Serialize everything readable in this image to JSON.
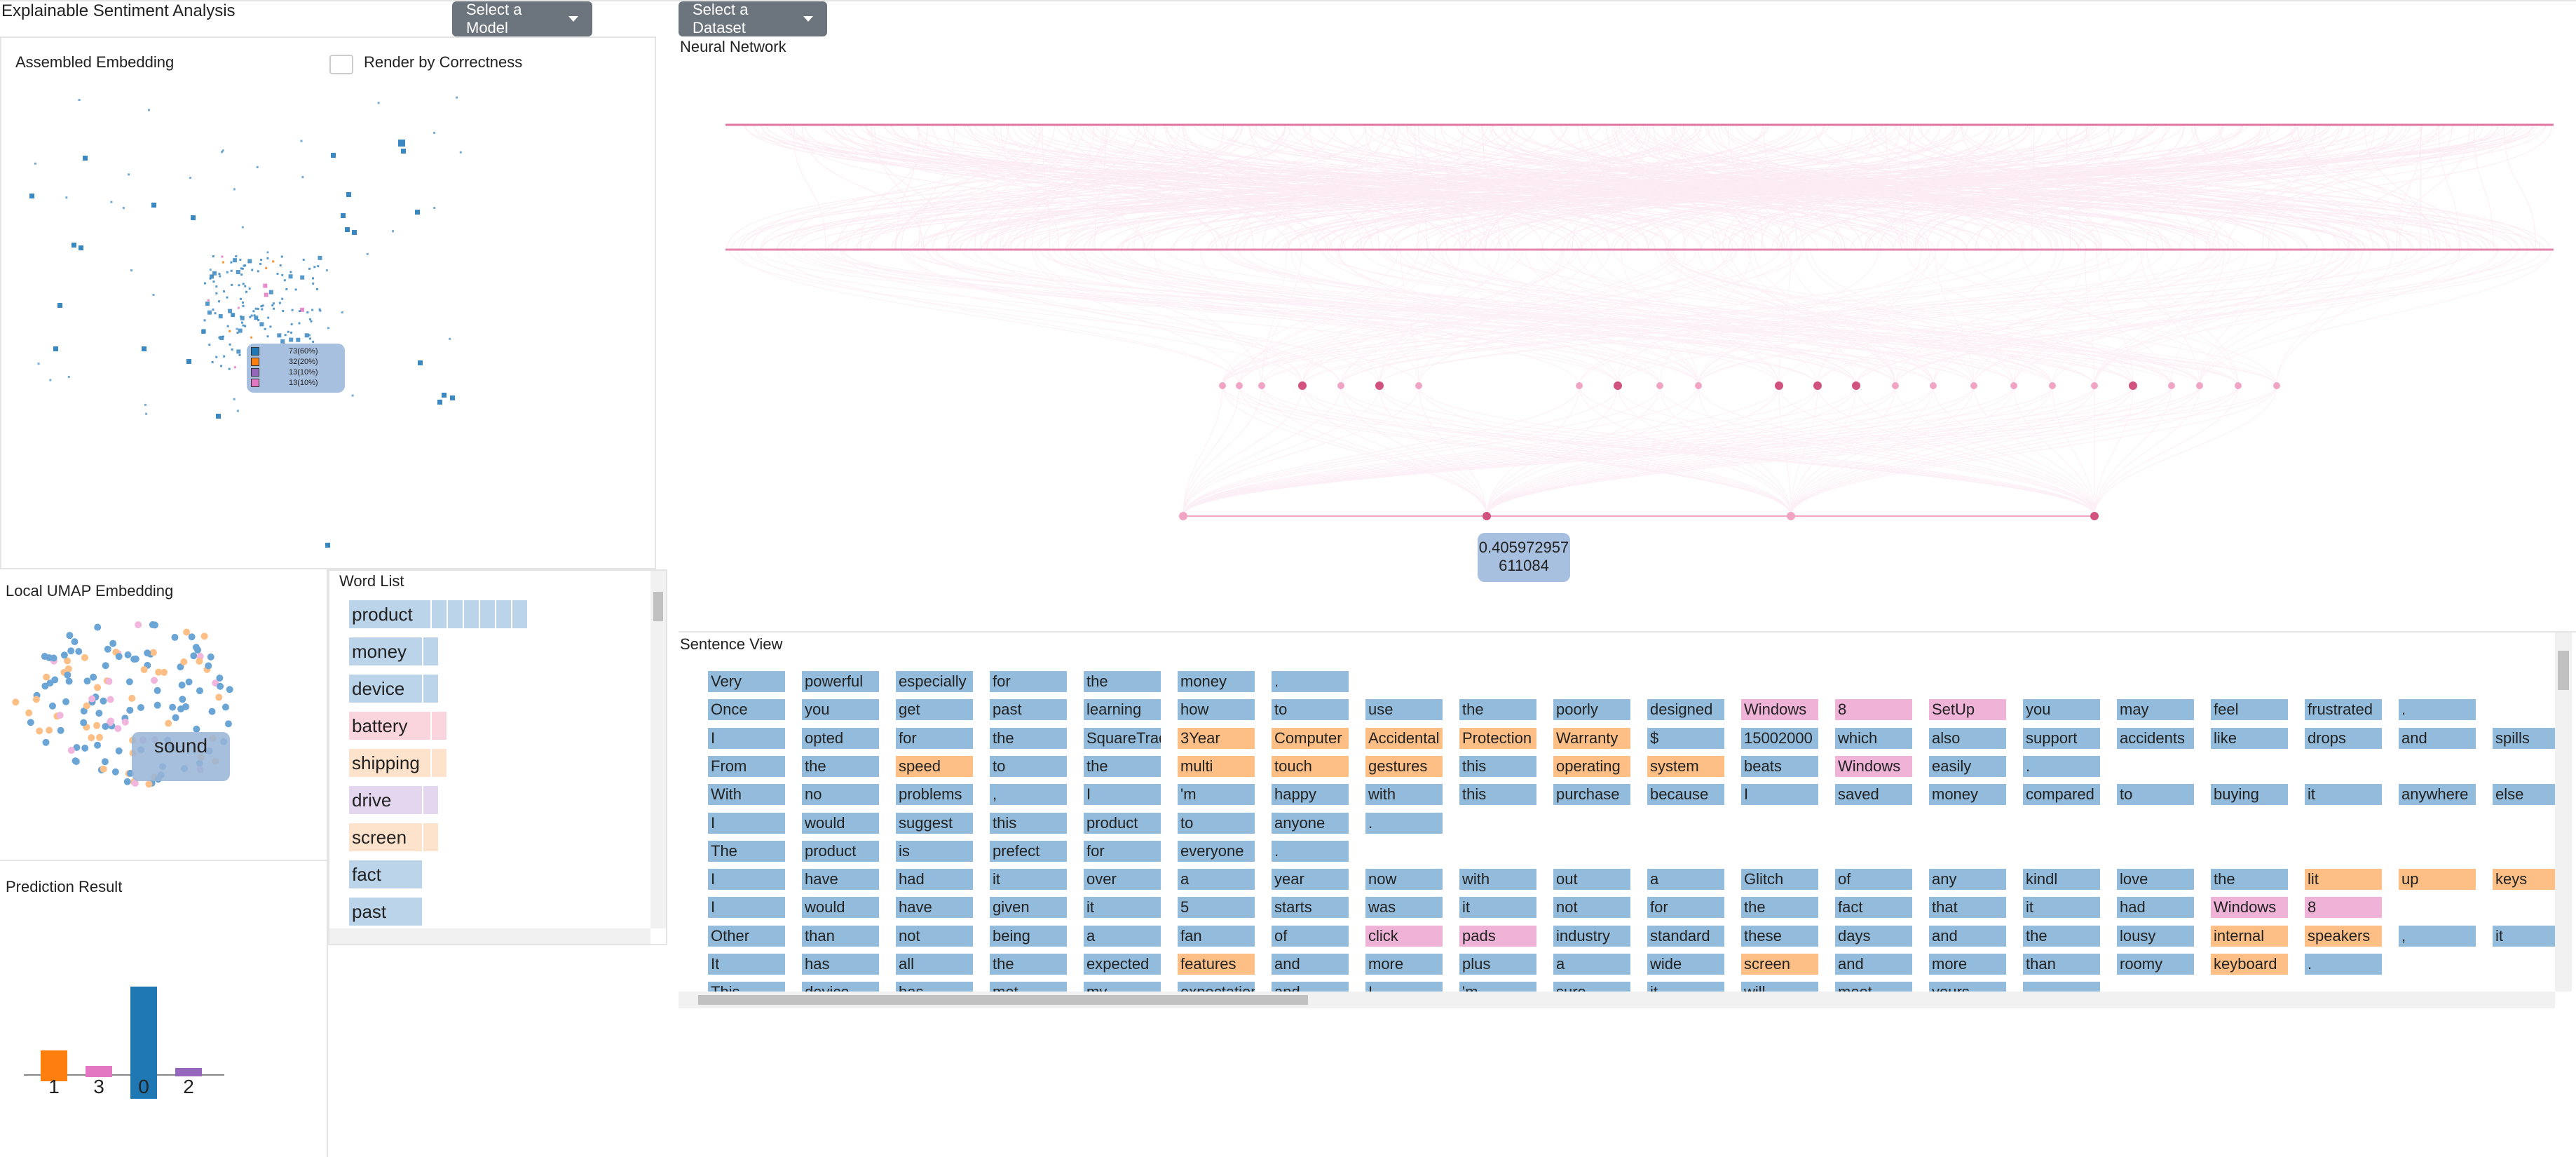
{
  "app": {
    "title": "Explainable Sentiment Analysis",
    "model_button": "Select a Model",
    "dataset_button": "Select a Dataset"
  },
  "assembled": {
    "title": "Assembled Embedding",
    "checkbox_label": "Render by Correctness",
    "tooltip": [
      "73(60%)",
      "32(20%)",
      "13(10%)",
      "13(10%)"
    ]
  },
  "neural": {
    "title": "Neural Network",
    "tooltip_line1": "0.405972957",
    "tooltip_line2": "611084"
  },
  "umap": {
    "title": "Local UMAP Embedding",
    "tooltip": "sound"
  },
  "wordlist": {
    "title": "Word List",
    "words": [
      {
        "w": "product",
        "c": "#bcd4ea",
        "n": 6
      },
      {
        "w": "money",
        "c": "#bcd4ea",
        "n": 1
      },
      {
        "w": "device",
        "c": "#bcd4ea",
        "n": 1
      },
      {
        "w": "battery",
        "c": "#fbd5dd",
        "n": 1
      },
      {
        "w": "shipping",
        "c": "#fde3cc",
        "n": 1
      },
      {
        "w": "drive",
        "c": "#e3d6ee",
        "n": 1
      },
      {
        "w": "screen",
        "c": "#fde3cc",
        "n": 1
      },
      {
        "w": "fact",
        "c": "#bcd4ea",
        "n": 0
      },
      {
        "w": "past",
        "c": "#bcd4ea",
        "n": 0
      }
    ]
  },
  "prediction": {
    "title": "Prediction Result",
    "bars": [
      {
        "label": "1",
        "value": 0.22,
        "color": "#ff7f0e"
      },
      {
        "label": "3",
        "value": 0.08,
        "color": "#e377c2"
      },
      {
        "label": "0",
        "value": 0.8,
        "color": "#1f77b4"
      },
      {
        "label": "2",
        "value": 0.06,
        "color": "#9467bd"
      }
    ]
  },
  "sentence": {
    "title": "Sentence View",
    "colors": {
      "b": "#93bcdc",
      "o": "#fdbf86",
      "p": "#f0b3d8"
    },
    "rows": [
      [
        [
          "Very",
          "b"
        ],
        [
          "powerful",
          "b"
        ],
        [
          "especially",
          "b"
        ],
        [
          "for",
          "b"
        ],
        [
          "the",
          "b"
        ],
        [
          "money",
          "b"
        ],
        [
          ".",
          "b"
        ]
      ],
      [
        [
          "Once",
          "b"
        ],
        [
          "you",
          "b"
        ],
        [
          "get",
          "b"
        ],
        [
          "past",
          "b"
        ],
        [
          "learning",
          "b"
        ],
        [
          "how",
          "b"
        ],
        [
          "to",
          "b"
        ],
        [
          "use",
          "b"
        ],
        [
          "the",
          "b"
        ],
        [
          "poorly",
          "b"
        ],
        [
          "designed",
          "b"
        ],
        [
          "Windows",
          "p"
        ],
        [
          "8",
          "p"
        ],
        [
          "SetUp",
          "p"
        ],
        [
          "you",
          "b"
        ],
        [
          "may",
          "b"
        ],
        [
          "feel",
          "b"
        ],
        [
          "frustrated",
          "b"
        ],
        [
          ".",
          "b"
        ]
      ],
      [
        [
          "I",
          "b"
        ],
        [
          "opted",
          "b"
        ],
        [
          "for",
          "b"
        ],
        [
          "the",
          "b"
        ],
        [
          "SquareTrade",
          "b"
        ],
        [
          "3Year",
          "o"
        ],
        [
          "Computer",
          "o"
        ],
        [
          "Accidental",
          "o"
        ],
        [
          "Protection",
          "o"
        ],
        [
          "Warranty",
          "o"
        ],
        [
          "$",
          "b"
        ],
        [
          "15002000",
          "b"
        ],
        [
          "which",
          "b"
        ],
        [
          "also",
          "b"
        ],
        [
          "support",
          "b"
        ],
        [
          "accidents",
          "b"
        ],
        [
          "like",
          "b"
        ],
        [
          "drops",
          "b"
        ],
        [
          "and",
          "b"
        ],
        [
          "spills",
          "b"
        ]
      ],
      [
        [
          "From",
          "b"
        ],
        [
          "the",
          "b"
        ],
        [
          "speed",
          "o"
        ],
        [
          "to",
          "b"
        ],
        [
          "the",
          "b"
        ],
        [
          "multi",
          "o"
        ],
        [
          "touch",
          "o"
        ],
        [
          "gestures",
          "o"
        ],
        [
          "this",
          "b"
        ],
        [
          "operating",
          "o"
        ],
        [
          "system",
          "o"
        ],
        [
          "beats",
          "b"
        ],
        [
          "Windows",
          "p"
        ],
        [
          "easily",
          "b"
        ],
        [
          ".",
          "b"
        ]
      ],
      [
        [
          "With",
          "b"
        ],
        [
          "no",
          "b"
        ],
        [
          "problems",
          "b"
        ],
        [
          ",",
          "b"
        ],
        [
          "I",
          "b"
        ],
        [
          "'m",
          "b"
        ],
        [
          "happy",
          "b"
        ],
        [
          "with",
          "b"
        ],
        [
          "this",
          "b"
        ],
        [
          "purchase",
          "b"
        ],
        [
          "because",
          "b"
        ],
        [
          "I",
          "b"
        ],
        [
          "saved",
          "b"
        ],
        [
          "money",
          "b"
        ],
        [
          "compared",
          "b"
        ],
        [
          "to",
          "b"
        ],
        [
          "buying",
          "b"
        ],
        [
          "it",
          "b"
        ],
        [
          "anywhere",
          "b"
        ],
        [
          "else",
          "b"
        ]
      ],
      [
        [
          "I",
          "b"
        ],
        [
          "would",
          "b"
        ],
        [
          "suggest",
          "b"
        ],
        [
          "this",
          "b"
        ],
        [
          "product",
          "b"
        ],
        [
          "to",
          "b"
        ],
        [
          "anyone",
          "b"
        ],
        [
          ".",
          "b"
        ]
      ],
      [
        [
          "The",
          "b"
        ],
        [
          "product",
          "b"
        ],
        [
          "is",
          "b"
        ],
        [
          "prefect",
          "b"
        ],
        [
          "for",
          "b"
        ],
        [
          "everyone",
          "b"
        ],
        [
          ".",
          "b"
        ]
      ],
      [
        [
          "I",
          "b"
        ],
        [
          "have",
          "b"
        ],
        [
          "had",
          "b"
        ],
        [
          "it",
          "b"
        ],
        [
          "over",
          "b"
        ],
        [
          "a",
          "b"
        ],
        [
          "year",
          "b"
        ],
        [
          "now",
          "b"
        ],
        [
          "with",
          "b"
        ],
        [
          "out",
          "b"
        ],
        [
          "a",
          "b"
        ],
        [
          "Glitch",
          "b"
        ],
        [
          "of",
          "b"
        ],
        [
          "any",
          "b"
        ],
        [
          "kindl",
          "b"
        ],
        [
          "love",
          "b"
        ],
        [
          "the",
          "b"
        ],
        [
          "lit",
          "o"
        ],
        [
          "up",
          "o"
        ],
        [
          "keys",
          "o"
        ]
      ],
      [
        [
          "I",
          "b"
        ],
        [
          "would",
          "b"
        ],
        [
          "have",
          "b"
        ],
        [
          "given",
          "b"
        ],
        [
          "it",
          "b"
        ],
        [
          "5",
          "b"
        ],
        [
          "starts",
          "b"
        ],
        [
          "was",
          "b"
        ],
        [
          "it",
          "b"
        ],
        [
          "not",
          "b"
        ],
        [
          "for",
          "b"
        ],
        [
          "the",
          "b"
        ],
        [
          "fact",
          "b"
        ],
        [
          "that",
          "b"
        ],
        [
          "it",
          "b"
        ],
        [
          "had",
          "b"
        ],
        [
          "Windows",
          "p"
        ],
        [
          "8",
          "p"
        ]
      ],
      [
        [
          "Other",
          "b"
        ],
        [
          "than",
          "b"
        ],
        [
          "not",
          "b"
        ],
        [
          "being",
          "b"
        ],
        [
          "a",
          "b"
        ],
        [
          "fan",
          "b"
        ],
        [
          "of",
          "b"
        ],
        [
          "click",
          "p"
        ],
        [
          "pads",
          "p"
        ],
        [
          "industry",
          "b"
        ],
        [
          "standard",
          "b"
        ],
        [
          "these",
          "b"
        ],
        [
          "days",
          "b"
        ],
        [
          "and",
          "b"
        ],
        [
          "the",
          "b"
        ],
        [
          "lousy",
          "b"
        ],
        [
          "internal",
          "o"
        ],
        [
          "speakers",
          "o"
        ],
        [
          ",",
          "b"
        ],
        [
          "it",
          "b"
        ]
      ],
      [
        [
          "It",
          "b"
        ],
        [
          "has",
          "b"
        ],
        [
          "all",
          "b"
        ],
        [
          "the",
          "b"
        ],
        [
          "expected",
          "b"
        ],
        [
          "features",
          "o"
        ],
        [
          "and",
          "b"
        ],
        [
          "more",
          "b"
        ],
        [
          "plus",
          "b"
        ],
        [
          "a",
          "b"
        ],
        [
          "wide",
          "b"
        ],
        [
          "screen",
          "o"
        ],
        [
          "and",
          "b"
        ],
        [
          "more",
          "b"
        ],
        [
          "than",
          "b"
        ],
        [
          "roomy",
          "b"
        ],
        [
          "keyboard",
          "o"
        ],
        [
          ".",
          "b"
        ]
      ],
      [
        [
          "This",
          "b"
        ],
        [
          "device",
          "b"
        ],
        [
          "has",
          "b"
        ],
        [
          "met",
          "b"
        ],
        [
          "my",
          "b"
        ],
        [
          "expectations",
          "b"
        ],
        [
          "and",
          "b"
        ],
        [
          "I",
          "b"
        ],
        [
          "'m",
          "b"
        ],
        [
          "sure",
          "b"
        ],
        [
          "it",
          "b"
        ],
        [
          "will",
          "b"
        ],
        [
          "meet",
          "b"
        ],
        [
          "yours",
          "b"
        ],
        [
          ".",
          "b"
        ]
      ]
    ]
  }
}
